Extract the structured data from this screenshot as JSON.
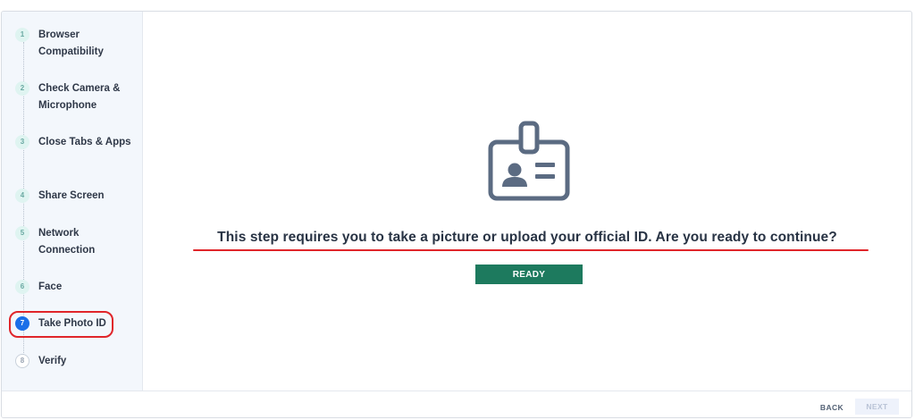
{
  "sidebar": {
    "steps": [
      {
        "number": "1",
        "label": "Browser Compatibility",
        "state": "done"
      },
      {
        "number": "2",
        "label": "Check Camera & Microphone",
        "state": "done"
      },
      {
        "number": "3",
        "label": "Close Tabs & Apps",
        "state": "done"
      },
      {
        "number": "4",
        "label": "Share Screen",
        "state": "done"
      },
      {
        "number": "5",
        "label": "Network Connection",
        "state": "done"
      },
      {
        "number": "6",
        "label": "Face",
        "state": "done"
      },
      {
        "number": "7",
        "label": "Take Photo ID",
        "state": "active"
      },
      {
        "number": "8",
        "label": "Verify",
        "state": "pending"
      }
    ]
  },
  "main": {
    "icon": "id-badge-icon",
    "prompt": "This step requires you to take a picture or upload your official ID. Are you ready to continue?",
    "ready_label": "READY"
  },
  "footer": {
    "back_label": "BACK",
    "next_label": "NEXT"
  },
  "colors": {
    "accent_active": "#1b6fe8",
    "ready_button": "#1d7a5e",
    "annotation_red": "#e0252a",
    "icon_slate": "#5b6b82"
  }
}
